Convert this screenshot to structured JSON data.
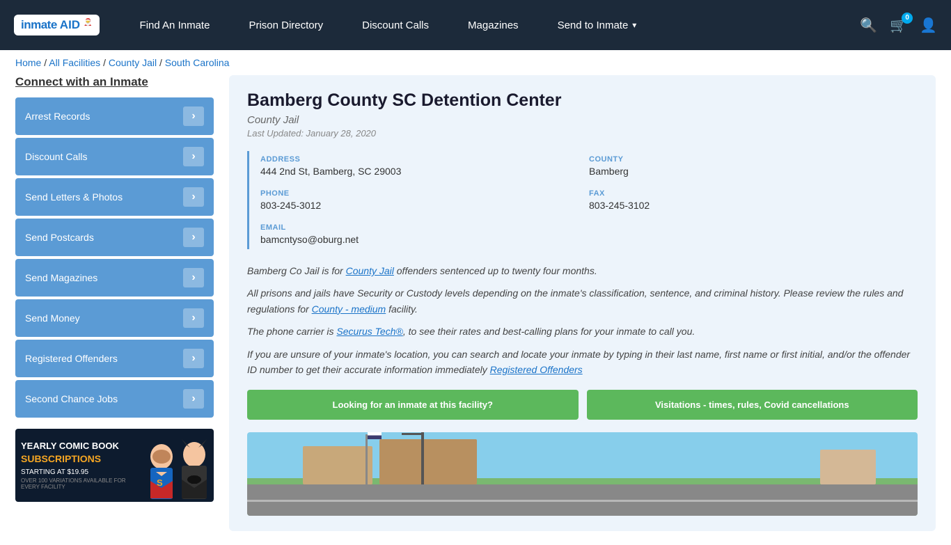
{
  "navbar": {
    "logo": {
      "text_inmate": "inmate",
      "text_aid": "AID",
      "hat": "🎅"
    },
    "links": [
      {
        "id": "find-inmate",
        "label": "Find An Inmate"
      },
      {
        "id": "prison-directory",
        "label": "Prison Directory"
      },
      {
        "id": "discount-calls",
        "label": "Discount Calls"
      },
      {
        "id": "magazines",
        "label": "Magazines"
      },
      {
        "id": "send-to-inmate",
        "label": "Send to Inmate",
        "dropdown": true
      }
    ],
    "cart_count": "0",
    "icons": {
      "search": "🔍",
      "cart": "🛒",
      "user": "👤"
    }
  },
  "breadcrumb": {
    "items": [
      {
        "label": "Home",
        "href": "#"
      },
      {
        "label": "All Facilities",
        "href": "#"
      },
      {
        "label": "County Jail",
        "href": "#"
      },
      {
        "label": "South Carolina",
        "href": "#"
      }
    ]
  },
  "sidebar": {
    "title": "Connect with an Inmate",
    "items": [
      {
        "label": "Arrest Records"
      },
      {
        "label": "Discount Calls"
      },
      {
        "label": "Send Letters & Photos"
      },
      {
        "label": "Send Postcards"
      },
      {
        "label": "Send Magazines"
      },
      {
        "label": "Send Money"
      },
      {
        "label": "Registered Offenders"
      },
      {
        "label": "Second Chance Jobs"
      }
    ],
    "ad": {
      "line1": "YEARLY COMIC BOOK",
      "line2": "SUBSCRIPTIONS",
      "line3": "STARTING AT $19.95",
      "line4": "OVER 100 VARIATIONS AVAILABLE FOR EVERY FACILITY"
    }
  },
  "facility": {
    "title": "Bamberg County SC Detention Center",
    "type": "County Jail",
    "last_updated": "Last Updated: January 28, 2020",
    "address_label": "ADDRESS",
    "address_value": "444 2nd St, Bamberg, SC 29003",
    "county_label": "COUNTY",
    "county_value": "Bamberg",
    "phone_label": "PHONE",
    "phone_value": "803-245-3012",
    "fax_label": "FAX",
    "fax_value": "803-245-3102",
    "email_label": "EMAIL",
    "email_value": "bamcntyso@oburg.net",
    "description": [
      "Bamberg Co Jail is for County Jail offenders sentenced up to twenty four months.",
      "All prisons and jails have Security or Custody levels depending on the inmate's classification, sentence, and criminal history. Please review the rules and regulations for County - medium facility.",
      "The phone carrier is Securus Tech®, to see their rates and best-calling plans for your inmate to call you.",
      "If you are unsure of your inmate's location, you can search and locate your inmate by typing in their last name, first name or first initial, and/or the offender ID number to get their accurate information immediately Registered Offenders"
    ],
    "btn1": "Looking for an inmate at this facility?",
    "btn2": "Visitations - times, rules, Covid cancellations"
  }
}
